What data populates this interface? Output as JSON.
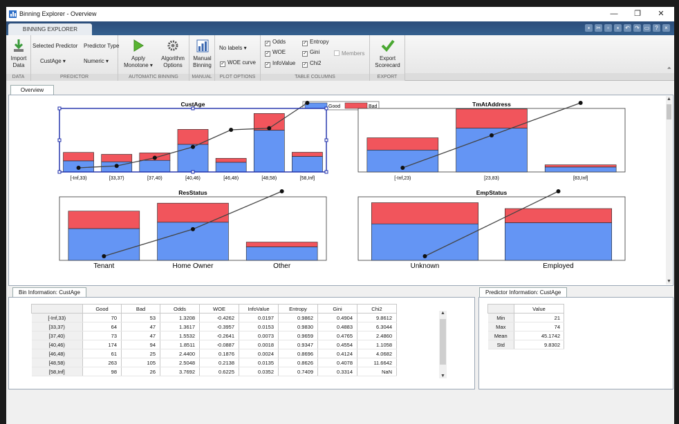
{
  "window": {
    "title": "Binning Explorer - Overview",
    "controls": [
      "—",
      "❐",
      "✕"
    ]
  },
  "ribbon": {
    "tab": "BINNING EXPLORER",
    "quick_icons": [
      "save-icon",
      "cut-icon",
      "copy-icon",
      "paste-icon",
      "undo-icon",
      "redo-icon",
      "layout-icon",
      "help-icon",
      "close-icon"
    ],
    "data": {
      "import_label": "Import\nData",
      "group": "DATA"
    },
    "predictor": {
      "selected_label": "Selected Predictor",
      "type_label": "Predictor Type",
      "selected_value": "CustAge",
      "type_value": "Numeric",
      "group": "PREDICTOR"
    },
    "automatic": {
      "apply_label": "Apply",
      "apply_value": "Monotone",
      "algorithm_label": "Algorithm\nOptions",
      "group": "AUTOMATIC BINNING"
    },
    "manual": {
      "label": "Manual\nBinning",
      "group": "MANUAL"
    },
    "plot_options": {
      "labels_dropdown": "No labels",
      "woe_curve": "WOE curve",
      "group": "PLOT OPTIONS"
    },
    "table_columns": {
      "odds": "Odds",
      "woe": "WOE",
      "infovalue": "InfoValue",
      "entropy": "Entropy",
      "gini": "Gini",
      "chi2": "Chi2",
      "members": "Members",
      "group": "TABLE COLUMNS"
    },
    "export": {
      "label": "Export\nScorecard",
      "group": "EXPORT"
    }
  },
  "overview_tab": "Overview",
  "legend": {
    "good": "Good",
    "bad": "Bad"
  },
  "colors": {
    "good": "#6495f4",
    "bad": "#f1555c",
    "selection": "#1a2aa8",
    "curve": "#444444"
  },
  "chart_data": [
    {
      "type": "bar",
      "title": "CustAge",
      "categories": [
        "[-Inf,33)",
        "[33,37)",
        "[37,40)",
        "[40,46)",
        "[46,48)",
        "[48,58)",
        "[58,Inf]"
      ],
      "series": [
        {
          "name": "Good",
          "values": [
            70,
            64,
            73,
            174,
            61,
            263,
            98
          ]
        },
        {
          "name": "Bad",
          "values": [
            53,
            47,
            47,
            94,
            25,
            105,
            26
          ]
        }
      ],
      "woe": [
        -0.4262,
        -0.3957,
        -0.2641,
        -0.0887,
        0.1876,
        0.2138,
        0.6225
      ],
      "ylim": [
        0,
        400
      ],
      "stacked": true,
      "selected": true
    },
    {
      "type": "bar",
      "title": "TmAtAddress",
      "categories": [
        "[-Inf,23)",
        "[23,83)",
        "[83,Inf]"
      ],
      "series": [
        {
          "name": "Good",
          "values": [
            200,
            400,
            45
          ]
        },
        {
          "name": "Bad",
          "values": [
            112,
            175,
            20
          ]
        }
      ],
      "woe": [
        -0.45,
        0.1,
        0.65
      ],
      "ylim": [
        0,
        580
      ],
      "stacked": true
    },
    {
      "type": "bar",
      "title": "ResStatus",
      "categories": [
        "Tenant",
        "Home Owner",
        "Other"
      ],
      "series": [
        {
          "name": "Good",
          "values": [
            200,
            240,
            85
          ]
        },
        {
          "name": "Bad",
          "values": [
            110,
            120,
            30
          ]
        }
      ],
      "woe": [
        -0.35,
        -0.1,
        0.25
      ],
      "ylim": [
        0,
        400
      ],
      "stacked": true
    },
    {
      "type": "bar",
      "title": "EmpStatus",
      "categories": [
        "Unknown",
        "Employed"
      ],
      "series": [
        {
          "name": "Good",
          "values": [
            310,
            320
          ]
        },
        {
          "name": "Bad",
          "values": [
            180,
            120
          ]
        }
      ],
      "woe": [
        -0.25,
        0.25
      ],
      "ylim": [
        0,
        540
      ],
      "stacked": true
    }
  ],
  "bin_info": {
    "tab": "Bin Information: CustAge",
    "columns": [
      "Good",
      "Bad",
      "Odds",
      "WOE",
      "InfoValue",
      "Entropy",
      "Gini",
      "Chi2"
    ],
    "rows": [
      {
        "bin": "[-Inf,33)",
        "cells": [
          "70",
          "53",
          "1.3208",
          "-0.4262",
          "0.0197",
          "0.9862",
          "0.4904",
          "9.8612"
        ]
      },
      {
        "bin": "[33,37)",
        "cells": [
          "64",
          "47",
          "1.3617",
          "-0.3957",
          "0.0153",
          "0.9830",
          "0.4883",
          "6.3044"
        ]
      },
      {
        "bin": "[37,40)",
        "cells": [
          "73",
          "47",
          "1.5532",
          "-0.2641",
          "0.0073",
          "0.9659",
          "0.4765",
          "2.4860"
        ]
      },
      {
        "bin": "[40,46)",
        "cells": [
          "174",
          "94",
          "1.8511",
          "-0.0887",
          "0.0018",
          "0.9347",
          "0.4554",
          "1.1058"
        ]
      },
      {
        "bin": "[46,48)",
        "cells": [
          "61",
          "25",
          "2.4400",
          "0.1876",
          "0.0024",
          "0.8696",
          "0.4124",
          "4.0682"
        ]
      },
      {
        "bin": "[48,58)",
        "cells": [
          "263",
          "105",
          "2.5048",
          "0.2138",
          "0.0135",
          "0.8626",
          "0.4078",
          "11.6642"
        ]
      },
      {
        "bin": "[58,Inf]",
        "cells": [
          "98",
          "26",
          "3.7692",
          "0.6225",
          "0.0352",
          "0.7409",
          "0.3314",
          "NaN"
        ]
      }
    ]
  },
  "predictor_info": {
    "tab": "Predictor Information: CustAge",
    "column": "Value",
    "rows": [
      {
        "label": "Min",
        "value": "21"
      },
      {
        "label": "Max",
        "value": "74"
      },
      {
        "label": "Mean",
        "value": "45.1742"
      },
      {
        "label": "Std",
        "value": "9.8302"
      }
    ]
  }
}
